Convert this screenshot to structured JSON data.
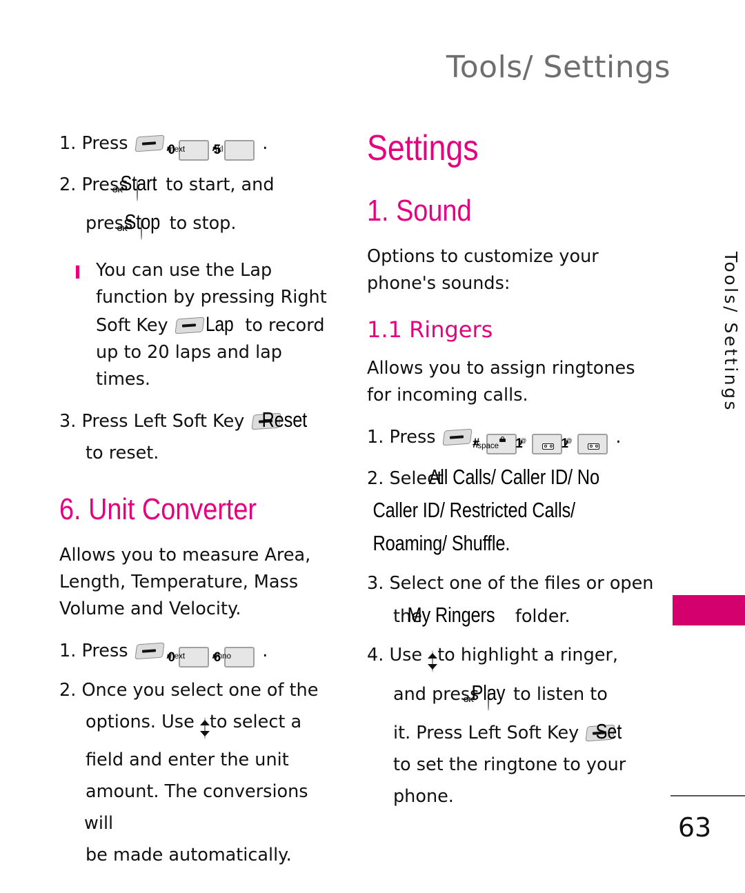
{
  "header": {
    "title": "Tools/ Settings"
  },
  "side_tab": {
    "label": "Tools/ Settings",
    "accent_color": "#d4006e"
  },
  "footer": {
    "page_number": "63"
  },
  "colors": {
    "magenta": "#e4007f",
    "tab_magenta": "#d4006e",
    "header_gray": "#6e6e6e",
    "body_black": "#111111"
  },
  "left_column": {
    "step1": {
      "num": "1. ",
      "press": "Press ",
      "comma1": ", ",
      "comma2": ", ",
      "period": " ."
    },
    "keys": {
      "softkey": "soft-key",
      "zero_next": {
        "digit": "0",
        "sub": "next"
      },
      "five_jkl": {
        "digit": "5",
        "sub": "jkl"
      },
      "six_mno": {
        "digit": "6",
        "sub": "mno"
      }
    },
    "step2": {
      "num": "2. ",
      "press1": "Press ",
      "label1": "Start",
      "mid": " to start, and",
      "line2_pre": "press ",
      "label2": "Stop",
      "line2_post": " to stop."
    },
    "bullet": {
      "line1": "You can use the Lap",
      "line2": "function by pressing Right",
      "line3_pre": "Soft Key ",
      "line3_label": "Lap",
      "line3_post": " to record",
      "line4": "up to 20 laps and lap",
      "line5": "times."
    },
    "step3": {
      "num": "3. ",
      "pre": "Press Left Soft Key ",
      "label": "Reset",
      "post": "to reset."
    },
    "heading_unit_converter": "6. Unit Converter",
    "unit_converter_desc": "Allows you to measure Area, Length, Temperature, Mass Volume and Velocity.",
    "uc_step1": {
      "num": "1. ",
      "press": "Press ",
      "comma1": ", ",
      "comma2": ", ",
      "period": " ."
    },
    "uc_step2": {
      "num": "2. ",
      "line1": "Once you select one of the",
      "line2_pre": "options. Use ",
      "line2_post": " to select a",
      "line3": "field and enter the unit",
      "line4": "amount. The conversions will",
      "line5": "be made automatically."
    }
  },
  "right_column": {
    "heading_settings": "Settings",
    "heading_sound": "1. Sound",
    "sound_desc": "Options to customize your phone's sounds:",
    "heading_ringers": "1.1 Ringers",
    "ringers_desc": "Allows you to assign ringtones for incoming calls.",
    "keys": {
      "softkey": "soft-key",
      "hash_space": {
        "digit": "#",
        "sub": "space"
      },
      "one_voicemail": {
        "digit": "1",
        "sub": "voicemail"
      }
    },
    "step1": {
      "num": "1. ",
      "press": "Press ",
      "comma1": ", ",
      "comma2": ", ",
      "comma3": ", ",
      "period": " ."
    },
    "step2": {
      "num": "2. ",
      "select": "Select ",
      "options_line1": "All Calls/ Caller ID/ No",
      "options_line2": "Caller ID/ Restricted Calls/",
      "options_line3": "Roaming/ Shuffle."
    },
    "step3": {
      "num": "3. ",
      "line1": "Select one of the files or open",
      "line2_pre": "the ",
      "line2_label": "My Ringers",
      "line2_post": " folder."
    },
    "step4": {
      "num": "4. ",
      "use": "Use ",
      "line1_post": " to highlight a ringer,",
      "line2_pre": "and press ",
      "line2_label": "Play",
      "line2_post": " to listen to",
      "line3_pre": "it. Press Left Soft Key ",
      "line3_label": "Set",
      "line4": "to set the ringtone to your",
      "line5": "phone."
    }
  }
}
